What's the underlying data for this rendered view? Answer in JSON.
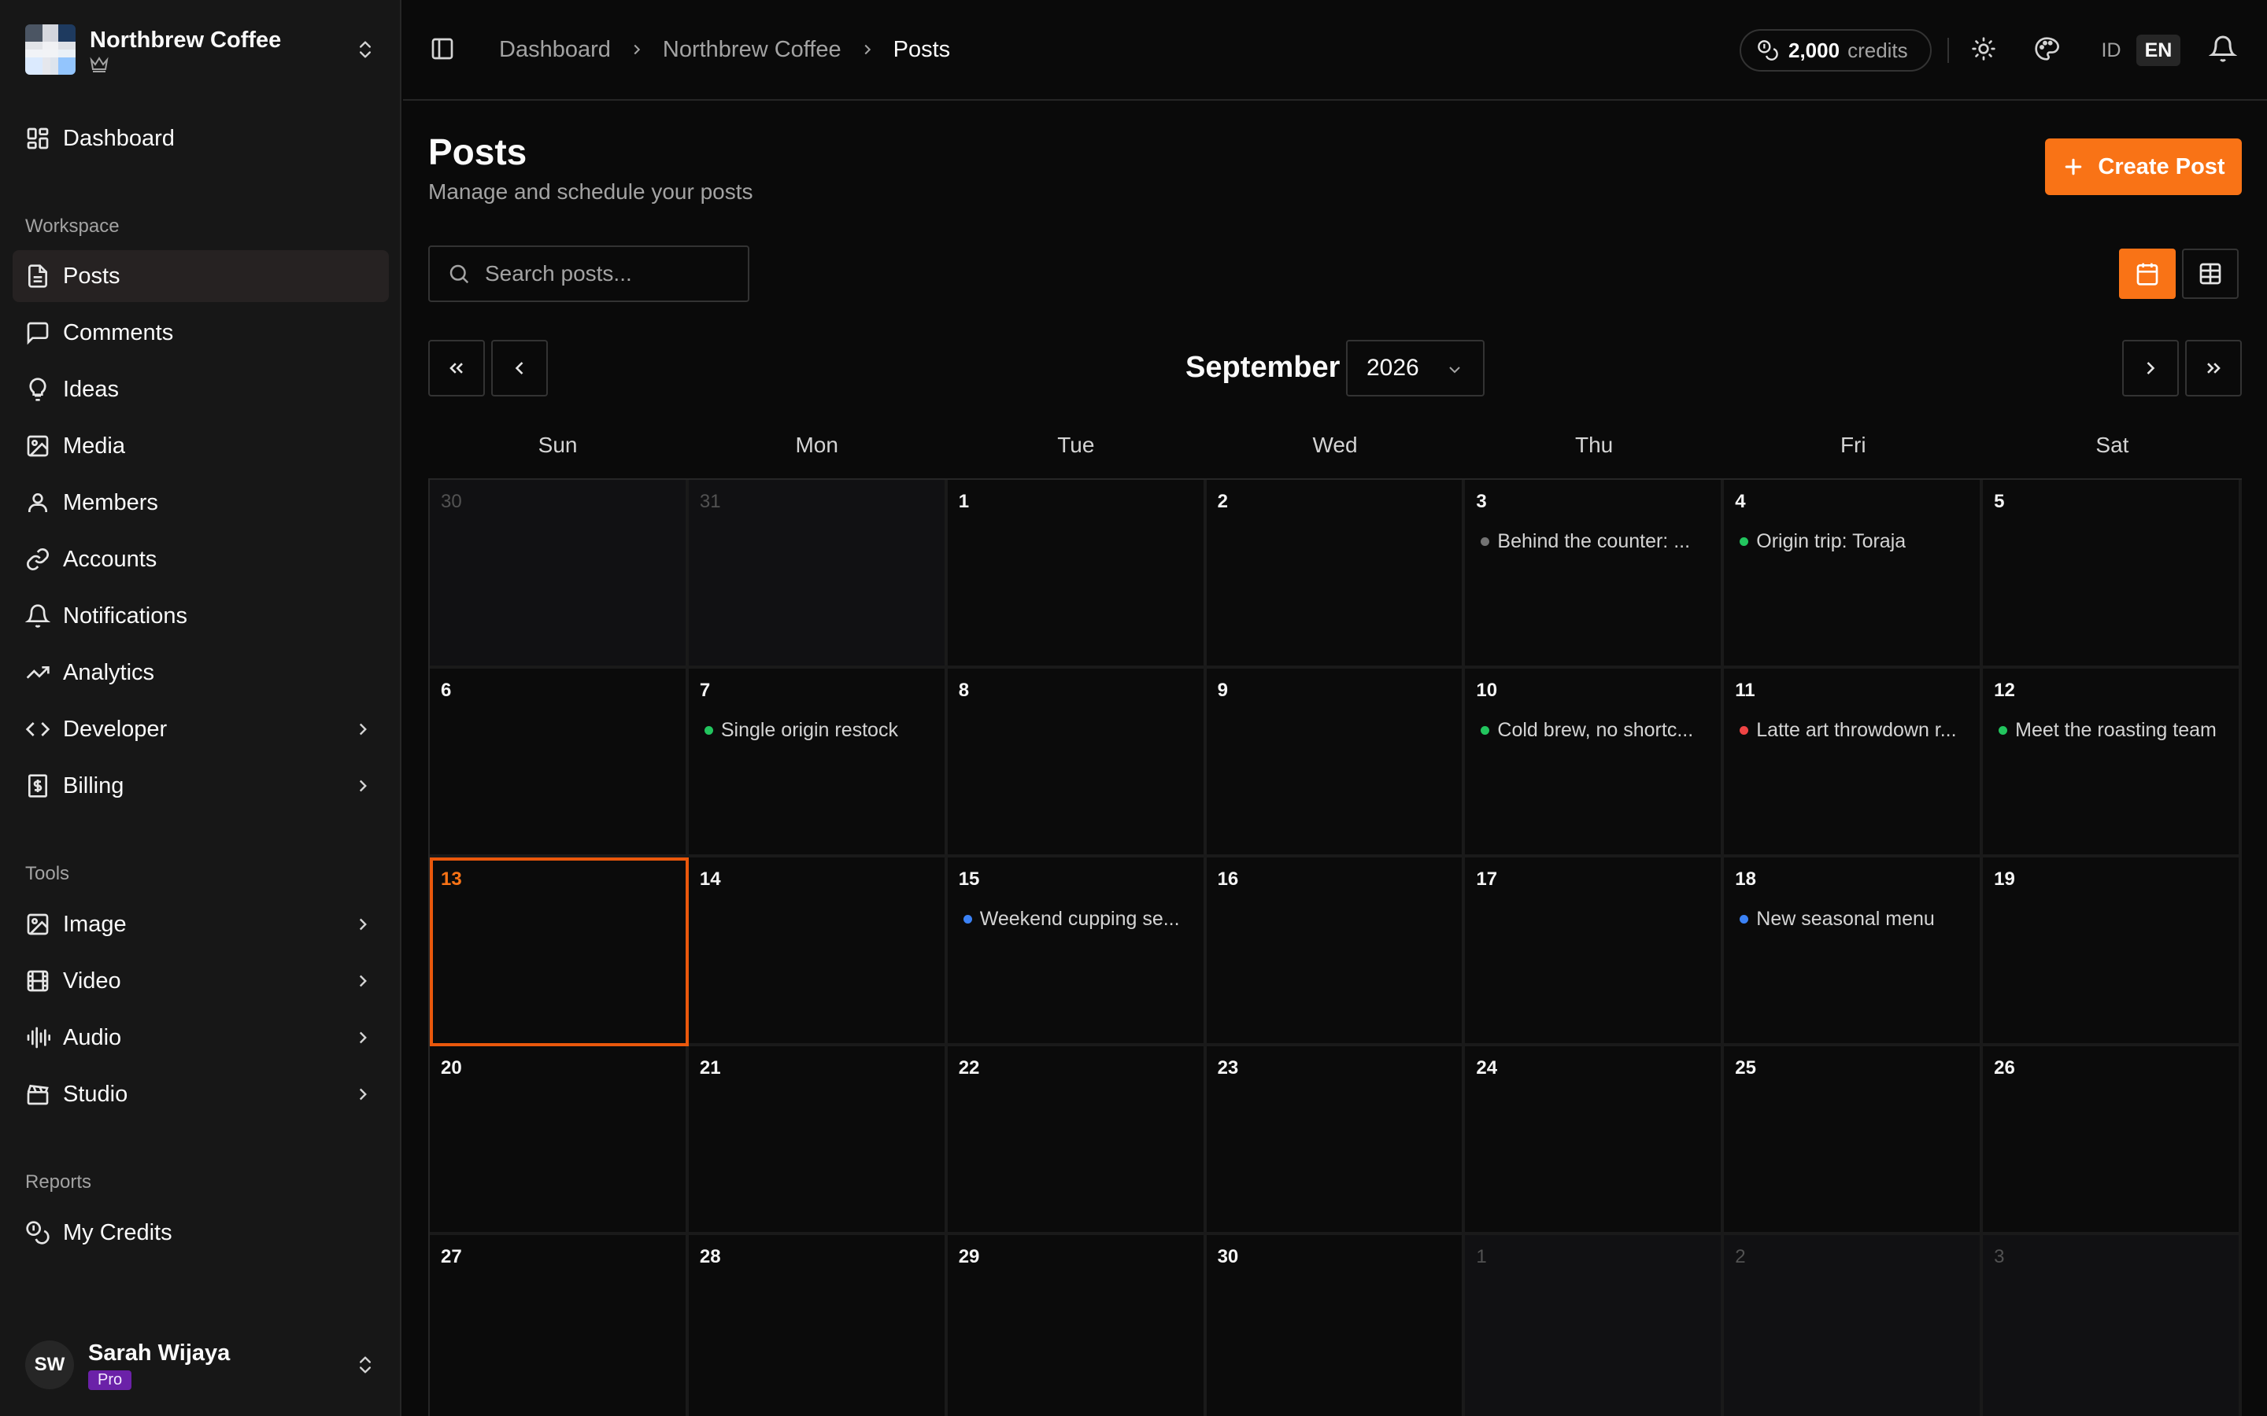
{
  "workspace": {
    "name": "Northbrew Coffee"
  },
  "sidebar": {
    "dashboard": "Dashboard",
    "workspace_label": "Workspace",
    "workspace_items": [
      {
        "label": "Posts",
        "icon": "file-text-icon",
        "active": true
      },
      {
        "label": "Comments",
        "icon": "message-square-icon"
      },
      {
        "label": "Ideas",
        "icon": "lightbulb-icon"
      },
      {
        "label": "Media",
        "icon": "image-icon"
      },
      {
        "label": "Members",
        "icon": "user-icon"
      },
      {
        "label": "Accounts",
        "icon": "link-icon"
      },
      {
        "label": "Notifications",
        "icon": "bell-icon"
      },
      {
        "label": "Analytics",
        "icon": "trending-up-icon"
      },
      {
        "label": "Developer",
        "icon": "code-icon",
        "expandable": true
      },
      {
        "label": "Billing",
        "icon": "receipt-icon",
        "expandable": true
      }
    ],
    "tools_label": "Tools",
    "tools_items": [
      {
        "label": "Image",
        "icon": "image-icon",
        "expandable": true
      },
      {
        "label": "Video",
        "icon": "film-icon",
        "expandable": true
      },
      {
        "label": "Audio",
        "icon": "audio-waveform-icon",
        "expandable": true
      },
      {
        "label": "Studio",
        "icon": "clapperboard-icon",
        "expandable": true
      }
    ],
    "reports_label": "Reports",
    "reports_items": [
      {
        "label": "My Credits",
        "icon": "coins-icon"
      }
    ],
    "user": {
      "initials": "SW",
      "name": "Sarah Wijaya",
      "plan": "Pro"
    }
  },
  "topbar": {
    "breadcrumb": [
      "Dashboard",
      "Northbrew Coffee",
      "Posts"
    ],
    "credits_value": "2,000",
    "credits_unit": "credits",
    "lang_id": "ID",
    "lang_en": "EN",
    "active_lang": "EN"
  },
  "main": {
    "title": "Posts",
    "subtitle": "Manage and schedule your posts",
    "create_label": "Create Post",
    "search_placeholder": "Search posts...",
    "month": "September",
    "year": "2026",
    "weekdays": [
      "Sun",
      "Mon",
      "Tue",
      "Wed",
      "Thu",
      "Fri",
      "Sat"
    ]
  },
  "colors": {
    "accent": "#f97316",
    "status_grey": "#737373",
    "status_green": "#22c55e",
    "status_red": "#ef4444",
    "status_blue": "#3b82f6"
  },
  "calendar": {
    "today": 13,
    "days": [
      {
        "d": "30",
        "outside": true
      },
      {
        "d": "31",
        "outside": true
      },
      {
        "d": "1"
      },
      {
        "d": "2"
      },
      {
        "d": "3",
        "event": {
          "title": "Behind the counter: ...",
          "status": "status_grey"
        }
      },
      {
        "d": "4",
        "event": {
          "title": "Origin trip: Toraja",
          "status": "status_green"
        }
      },
      {
        "d": "5"
      },
      {
        "d": "6"
      },
      {
        "d": "7",
        "event": {
          "title": "Single origin restock",
          "status": "status_green"
        }
      },
      {
        "d": "8"
      },
      {
        "d": "9"
      },
      {
        "d": "10",
        "event": {
          "title": "Cold brew, no shortc...",
          "status": "status_green"
        }
      },
      {
        "d": "11",
        "event": {
          "title": "Latte art throwdown r...",
          "status": "status_red"
        }
      },
      {
        "d": "12",
        "event": {
          "title": "Meet the roasting team",
          "status": "status_green"
        }
      },
      {
        "d": "13",
        "today": true
      },
      {
        "d": "14"
      },
      {
        "d": "15",
        "event": {
          "title": "Weekend cupping se...",
          "status": "status_blue"
        }
      },
      {
        "d": "16"
      },
      {
        "d": "17"
      },
      {
        "d": "18",
        "event": {
          "title": "New seasonal menu",
          "status": "status_blue"
        }
      },
      {
        "d": "19"
      },
      {
        "d": "20"
      },
      {
        "d": "21"
      },
      {
        "d": "22"
      },
      {
        "d": "23"
      },
      {
        "d": "24"
      },
      {
        "d": "25"
      },
      {
        "d": "26"
      },
      {
        "d": "27"
      },
      {
        "d": "28"
      },
      {
        "d": "29"
      },
      {
        "d": "30"
      },
      {
        "d": "1",
        "outside": true
      },
      {
        "d": "2",
        "outside": true
      },
      {
        "d": "3",
        "outside": true
      }
    ]
  }
}
